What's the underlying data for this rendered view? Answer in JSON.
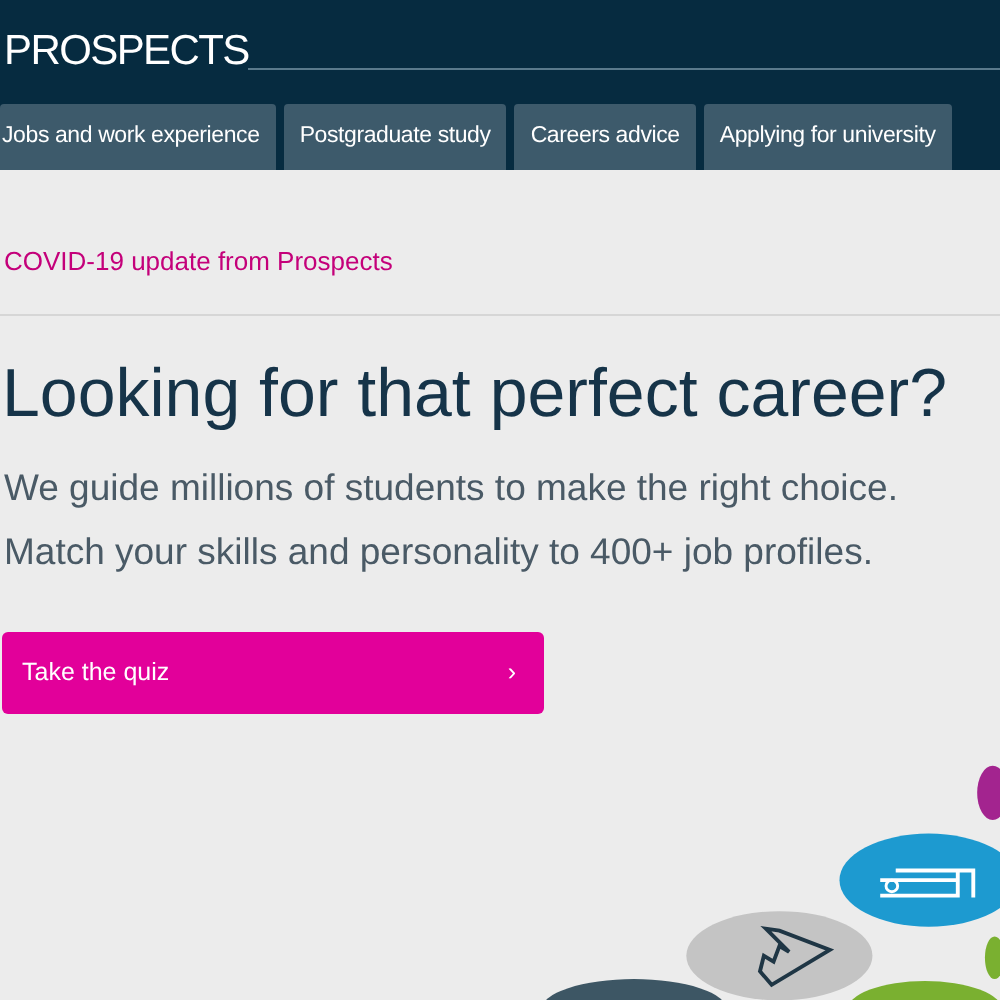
{
  "header": {
    "logo": "PROSPECTS"
  },
  "nav": [
    {
      "label": "Jobs and work experience"
    },
    {
      "label": "Postgraduate study"
    },
    {
      "label": "Careers advice"
    },
    {
      "label": "Applying for university"
    }
  ],
  "notice": "COVID-19 update from Prospects",
  "hero": {
    "title": "Looking for that perfect career?",
    "lines": [
      "We guide millions of students to make the right choice.",
      "Match your skills and personality to 400+ job profiles."
    ],
    "button": {
      "label": "Take the quiz",
      "chevron": "›"
    }
  }
}
